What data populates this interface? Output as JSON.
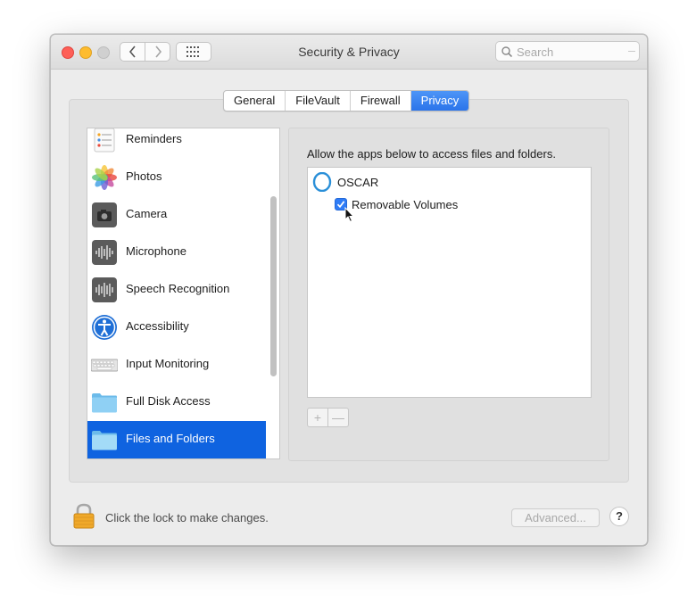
{
  "window": {
    "title": "Security & Privacy",
    "search_placeholder": "Search"
  },
  "tabs": [
    {
      "label": "General",
      "active": false
    },
    {
      "label": "FileVault",
      "active": false
    },
    {
      "label": "Firewall",
      "active": false
    },
    {
      "label": "Privacy",
      "active": true
    }
  ],
  "sidebar": {
    "items": [
      {
        "label": "Reminders",
        "icon": "reminders-icon"
      },
      {
        "label": "Photos",
        "icon": "photos-icon"
      },
      {
        "label": "Camera",
        "icon": "camera-icon"
      },
      {
        "label": "Microphone",
        "icon": "microphone-icon"
      },
      {
        "label": "Speech Recognition",
        "icon": "speech-recognition-icon"
      },
      {
        "label": "Accessibility",
        "icon": "accessibility-icon"
      },
      {
        "label": "Input Monitoring",
        "icon": "keyboard-icon"
      },
      {
        "label": "Full Disk Access",
        "icon": "folder-icon"
      },
      {
        "label": "Files and Folders",
        "icon": "folder-icon",
        "selected": true
      }
    ]
  },
  "panel": {
    "description": "Allow the apps below to access files and folders.",
    "apps": [
      {
        "name": "OSCAR",
        "permissions": [
          {
            "label": "Removable Volumes",
            "checked": true
          }
        ]
      }
    ],
    "add_label": "+",
    "remove_label": "—"
  },
  "footer": {
    "lock_text": "Click the lock to make changes.",
    "advanced_label": "Advanced...",
    "help_label": "?"
  },
  "colors": {
    "accent": "#2b74ea",
    "selection": "#0f63e0"
  }
}
